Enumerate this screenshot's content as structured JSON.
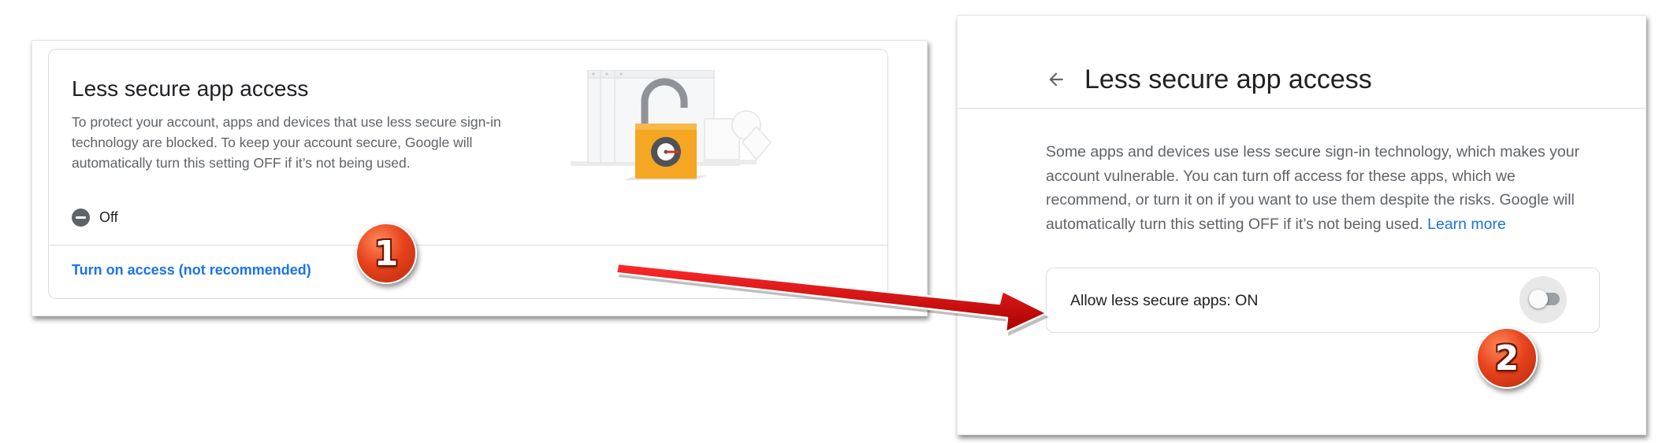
{
  "left_panel": {
    "title": "Less secure app access",
    "description": "To protect your account, apps and devices that use less secure sign-in technology are blocked. To keep your account secure, Google will automatically turn this setting OFF if it’s not being used.",
    "status_icon": "minus-circle-icon",
    "status": "Off",
    "link": "Turn on access (not recommended)",
    "illustration": "padlock-illustration"
  },
  "right_panel": {
    "back_icon": "arrow-left-icon",
    "title": "Less secure app access",
    "description": "Some apps and devices use less secure sign-in technology, which makes your account vulnerable. You can turn off access for these apps, which we recommend, or turn it on if you want to use them despite the risks. Google will automatically turn this setting OFF if it’s not being used.",
    "learn_more": "Learn more",
    "toggle_label": "Allow less secure apps: ON",
    "toggle_on": false
  },
  "annotations": {
    "step1": "1",
    "step2": "2",
    "arrow_color": "#d00000"
  },
  "colors": {
    "link": "#1a73e8",
    "text_secondary": "#5f6368",
    "lock_body": "#f5a623",
    "badge": "#e8431c"
  }
}
